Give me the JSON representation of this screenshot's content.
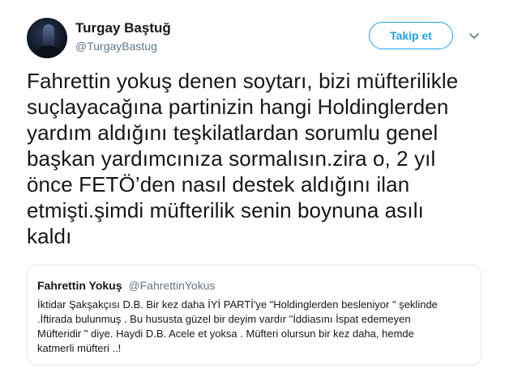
{
  "tweet": {
    "author_name": "Turgay Baştuğ",
    "author_handle": "@TurgayBastug",
    "follow_label": "Takip et",
    "avatar_icon": "profile-photo",
    "menu_icon": "chevron-down-icon",
    "text": "Fahrettin yokuş denen soytarı, bizi müfterilikle\nsuçlayacağına partinizin hangi Holdinglerden\nyardım aldığını teşkilatlardan sorumlu genel\nbaşkan yardımcınıza sormalısın.zira o, 2 yıl\nönce FETÖ’den nasıl destek aldığını ilan\netmişti.şimdi müfterilik senin boynuna asılı\nkaldı"
  },
  "quoted_tweet": {
    "author_name": "Fahrettin Yokuş",
    "author_handle": "@FahrettinYokus",
    "text": "İktidar Şakşakçısı D.B. Bir kez daha İYİ PARTİ'ye \"Holdinglerden besleniyor \" şeklinde\n.İftirada bulunmuş . Bu hususta güzel bir deyim vardır \"İddiasını İspat edemeyen\nMüfteridir \" diye. Haydi D.B. Acele et yoksa . Müfteri olursun bir kez daha, hemde\nkatmerli müfteri ..!"
  },
  "colors": {
    "accent": "#1da1f2",
    "text": "#14171a",
    "secondary": "#657786",
    "border": "#e1e8ed"
  }
}
